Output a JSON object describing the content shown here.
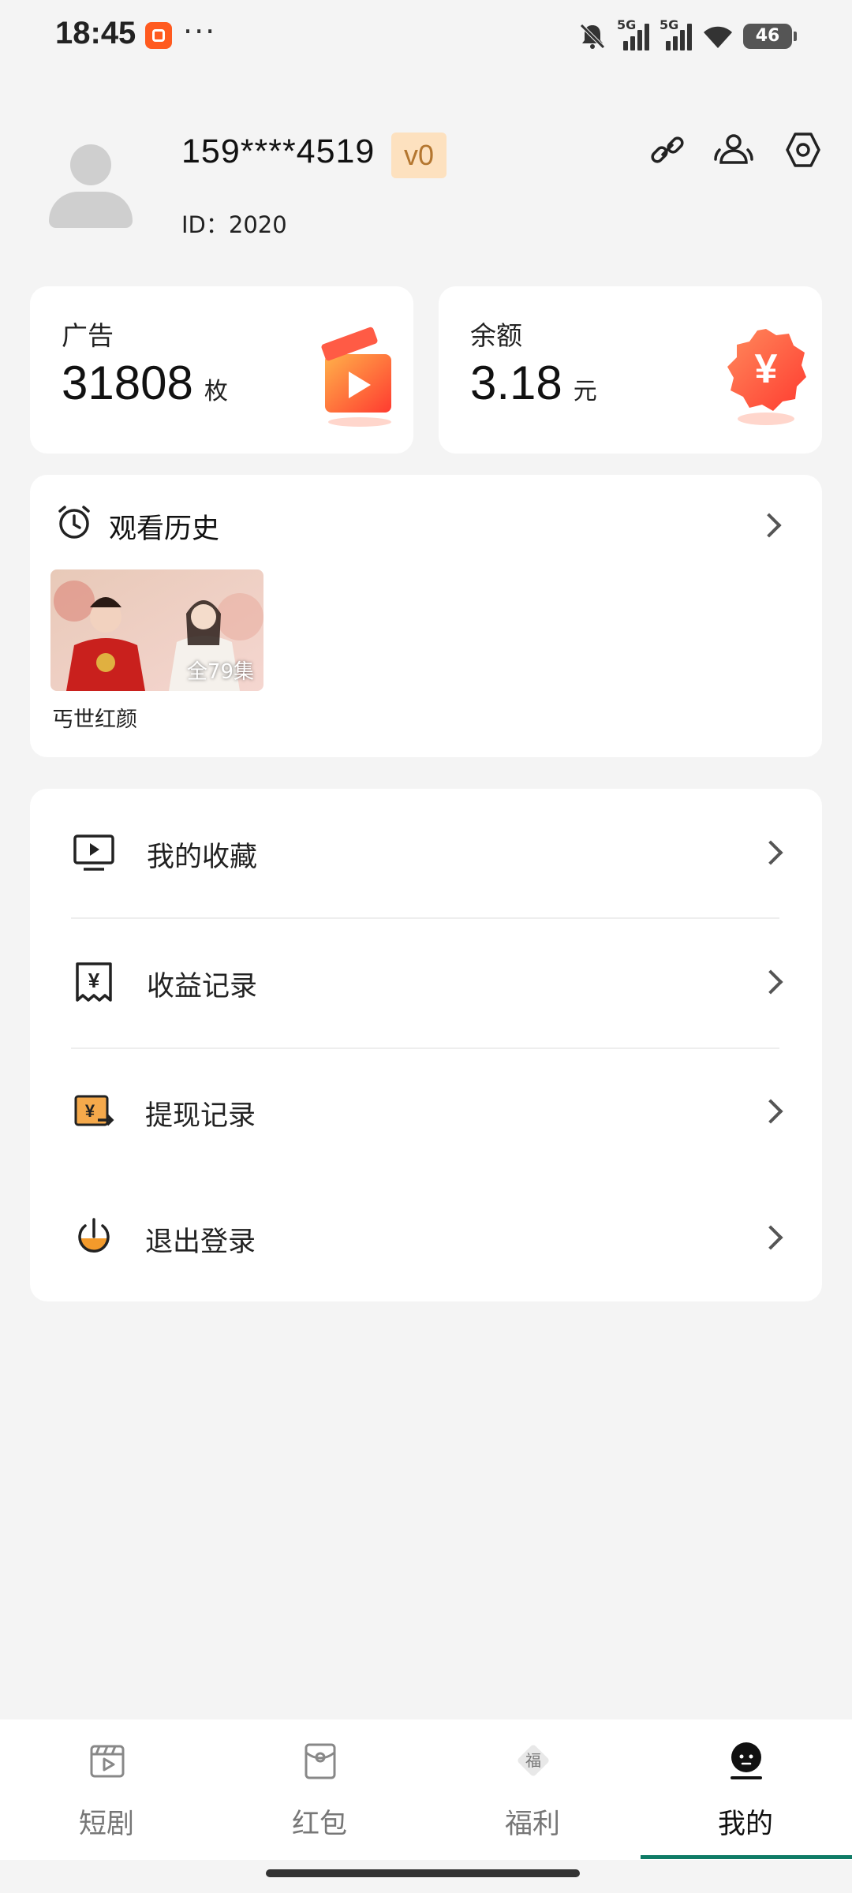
{
  "status_bar": {
    "time": "18:45",
    "dots": "···",
    "signal_1_label": "5G",
    "signal_2_label": "5G",
    "battery": "46"
  },
  "profile": {
    "phone": "159****4519",
    "vip_level": "v0",
    "user_id": "ID：2020"
  },
  "stats": {
    "ads": {
      "label": "广告",
      "value": "31808",
      "unit": "枚"
    },
    "balance": {
      "label": "余额",
      "value": "3.18",
      "unit": "元"
    }
  },
  "history": {
    "title": "观看历史",
    "items": [
      {
        "title": "丐世红颜",
        "episodes": "全79集"
      }
    ]
  },
  "menu": [
    {
      "label": "我的收藏",
      "icon": "tv-icon"
    },
    {
      "label": "收益记录",
      "icon": "receipt-yen-icon"
    },
    {
      "label": "提现记录",
      "icon": "withdraw-icon"
    },
    {
      "label": "退出登录",
      "icon": "power-icon"
    }
  ],
  "bottom_nav": [
    {
      "label": "短剧",
      "icon": "clapper-icon"
    },
    {
      "label": "红包",
      "icon": "red-envelope-icon"
    },
    {
      "label": "福利",
      "icon": "fu-diamond-icon",
      "glyph": "福"
    },
    {
      "label": "我的",
      "icon": "profile-face-icon",
      "active": true
    }
  ],
  "colors": {
    "accent": "#0f7b66",
    "vip_bg": "#fde1bf",
    "vip_text": "#b4762f",
    "icon_orange": "#f39a2b",
    "ad_icon_red": "#ff4b3a"
  }
}
